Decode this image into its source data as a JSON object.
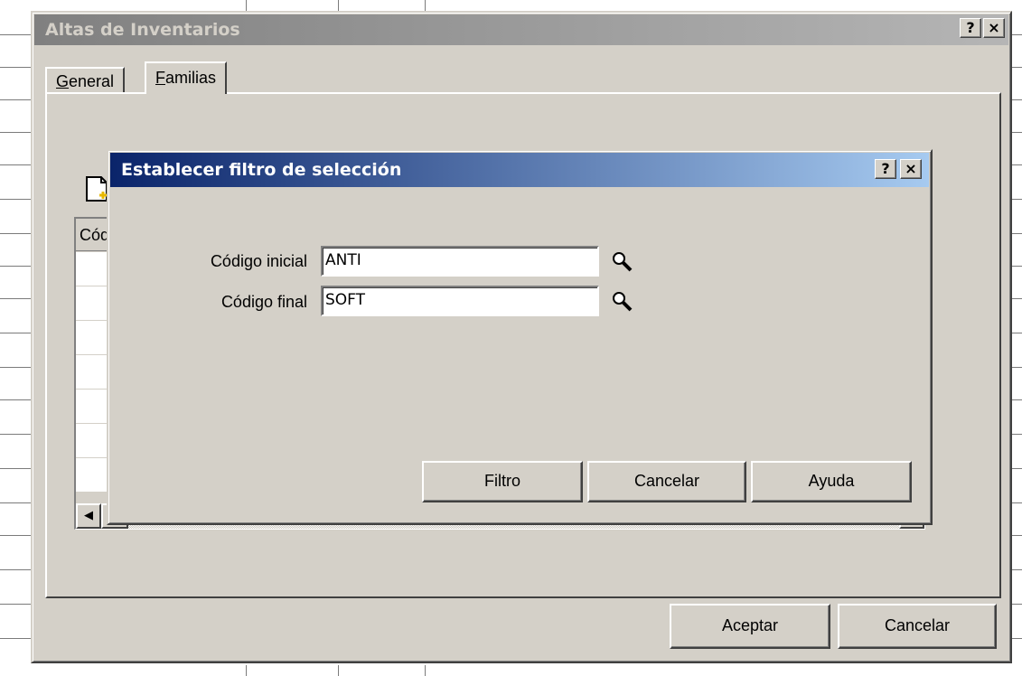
{
  "main_window": {
    "title": "Altas de  Inventarios",
    "help_btn": "?",
    "close_btn": "×",
    "tabs": [
      {
        "label_prefix": "",
        "accel": "G",
        "label_rest": "eneral"
      },
      {
        "label_prefix": "",
        "accel": "F",
        "label_rest": "amilias"
      }
    ],
    "grid_header": "Códig",
    "scroll_left": "◀",
    "scroll_right": "▶",
    "ok_label": "Aceptar",
    "cancel_label": "Cancelar"
  },
  "filter_dialog": {
    "title": "Establecer filtro de selección",
    "help_btn": "?",
    "close_btn": "×",
    "fields": [
      {
        "label": "Código inicial",
        "value": "ANTI"
      },
      {
        "label": "Código final",
        "value": "SOFT"
      }
    ],
    "buttons": {
      "filter": "Filtro",
      "cancel": "Cancelar",
      "help": "Ayuda"
    }
  },
  "icons": [
    "new-record-icon",
    "magnifier-icon"
  ],
  "colors": {
    "face": "#d4d0c8",
    "active_title_start": "#0a246a",
    "active_title_end": "#a6caf0",
    "inactive_title_start": "#808080",
    "inactive_title_end": "#b5b5b5"
  }
}
